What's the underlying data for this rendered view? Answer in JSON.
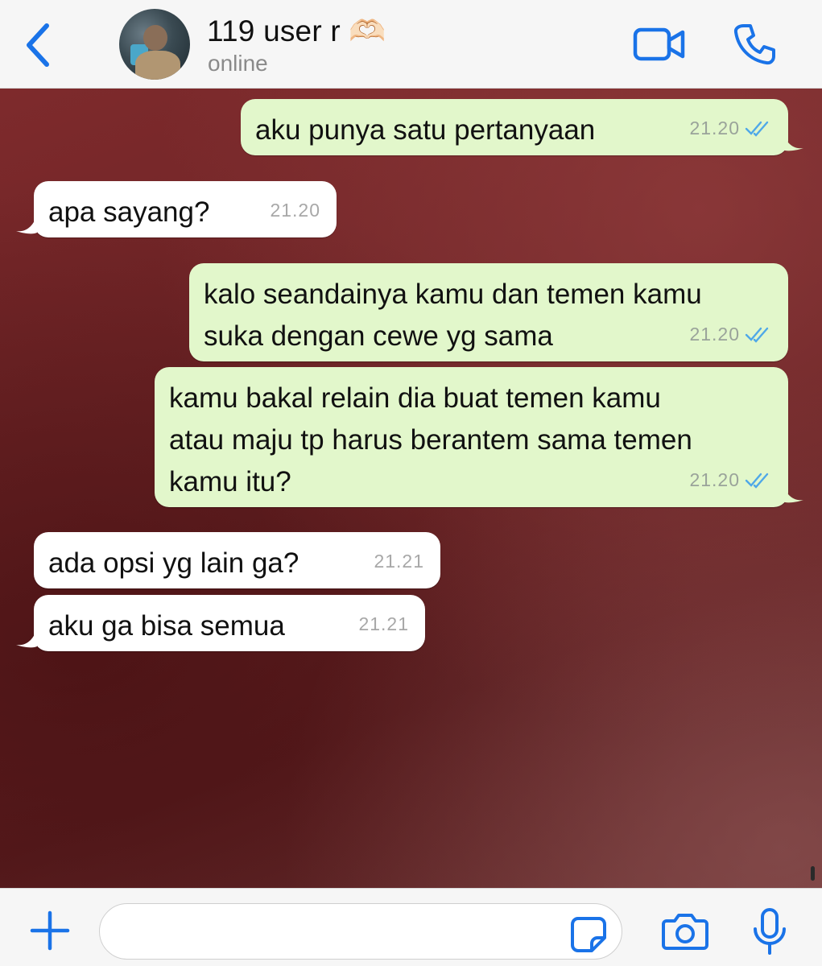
{
  "header": {
    "contact_name": "119 user r 🫶🏻",
    "status": "online",
    "icons": {
      "back": "chevron-left-icon",
      "video": "video-camera-icon",
      "phone": "phone-icon"
    }
  },
  "messages": [
    {
      "direction": "outgoing",
      "text": "aku punya satu pertanyaan",
      "time": "21.20",
      "read": true
    },
    {
      "direction": "incoming",
      "text": "apa sayang?",
      "time": "21.20"
    },
    {
      "direction": "outgoing",
      "text": "kalo seandainya kamu dan temen kamu\nsuka dengan cewe yg sama",
      "time": "21.20",
      "read": true
    },
    {
      "direction": "outgoing",
      "text": "kamu bakal relain dia buat temen kamu\natau maju tp harus berantem sama temen\nkamu itu?",
      "time": "21.20",
      "read": true
    },
    {
      "direction": "incoming",
      "text": "ada opsi yg lain ga?",
      "time": "21.21"
    },
    {
      "direction": "incoming",
      "text": "aku ga bisa semua",
      "time": "21.21"
    }
  ],
  "composer": {
    "placeholder": "",
    "value": "",
    "icons": {
      "plus": "plus-icon",
      "sticker": "sticker-icon",
      "camera": "camera-icon",
      "mic": "microphone-icon"
    }
  },
  "colors": {
    "accent": "#1a73e8",
    "outgoing_bubble": "#e2f7cb",
    "incoming_bubble": "#ffffff",
    "read_ticks": "#4fa8e8",
    "wallpaper": "#6a2325"
  }
}
